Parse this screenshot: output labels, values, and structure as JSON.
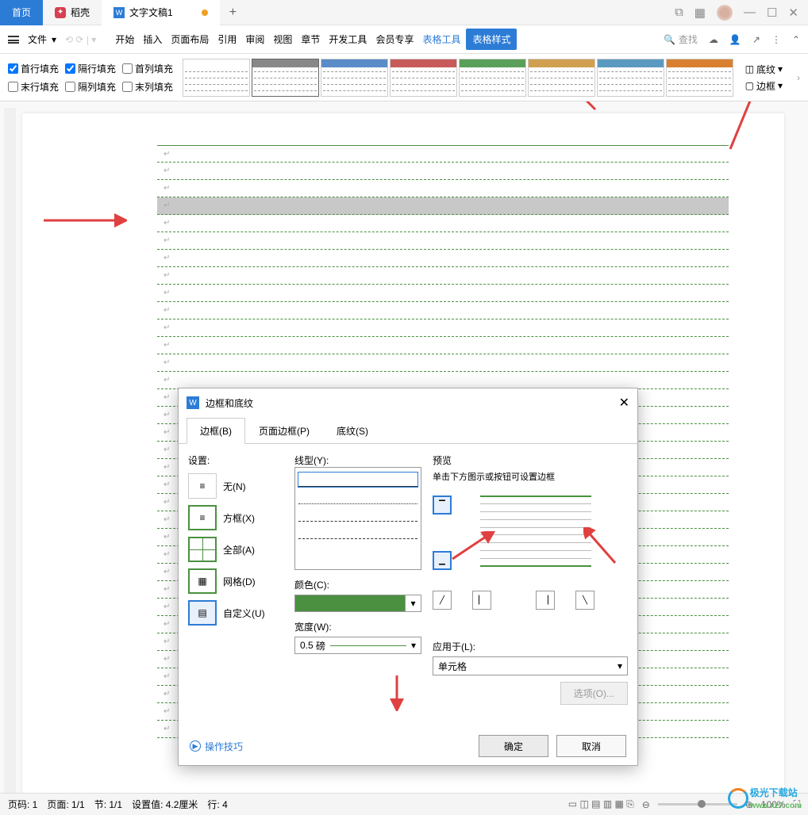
{
  "tabs": {
    "home": "首页",
    "shell": "稻壳",
    "doc": "文字文稿1"
  },
  "menu": {
    "file": "文件",
    "items": [
      "开始",
      "插入",
      "页面布局",
      "引用",
      "审阅",
      "视图",
      "章节",
      "开发工具",
      "会员专享",
      "表格工具",
      "表格样式"
    ],
    "search": "查找"
  },
  "ribbon": {
    "checks": {
      "r1c1": "首行填充",
      "r1c2": "隔行填充",
      "r1c3": "首列填充",
      "r2c1": "末行填充",
      "r2c2": "隔列填充",
      "r2c3": "末列填充"
    },
    "shading": "底纹",
    "border": "边框"
  },
  "dialog": {
    "title": "边框和底纹",
    "tabs": {
      "border": "边框(B)",
      "page": "页面边框(P)",
      "shading": "底纹(S)"
    },
    "settings_label": "设置:",
    "settings": {
      "none": "无(N)",
      "box": "方框(X)",
      "all": "全部(A)",
      "grid": "网格(D)",
      "custom": "自定义(U)"
    },
    "line_label": "线型(Y):",
    "color_label": "颜色(C):",
    "color_value": "#4a9040",
    "width_label": "宽度(W):",
    "width_value": "0.5",
    "width_unit": "磅",
    "preview_label": "预览",
    "preview_hint": "单击下方图示或按钮可设置边框",
    "apply_label": "应用于(L):",
    "apply_value": "单元格",
    "options": "选项(O)...",
    "tips": "操作技巧",
    "ok": "确定",
    "cancel": "取消"
  },
  "status": {
    "page_no": "页码: 1",
    "page": "页面: 1/1",
    "section": "节: 1/1",
    "setval": "设置值: 4.2厘米",
    "row": "行: 4",
    "zoom": "100%"
  },
  "watermark": {
    "name": "极光下载站",
    "url": "www.xz7.com"
  }
}
